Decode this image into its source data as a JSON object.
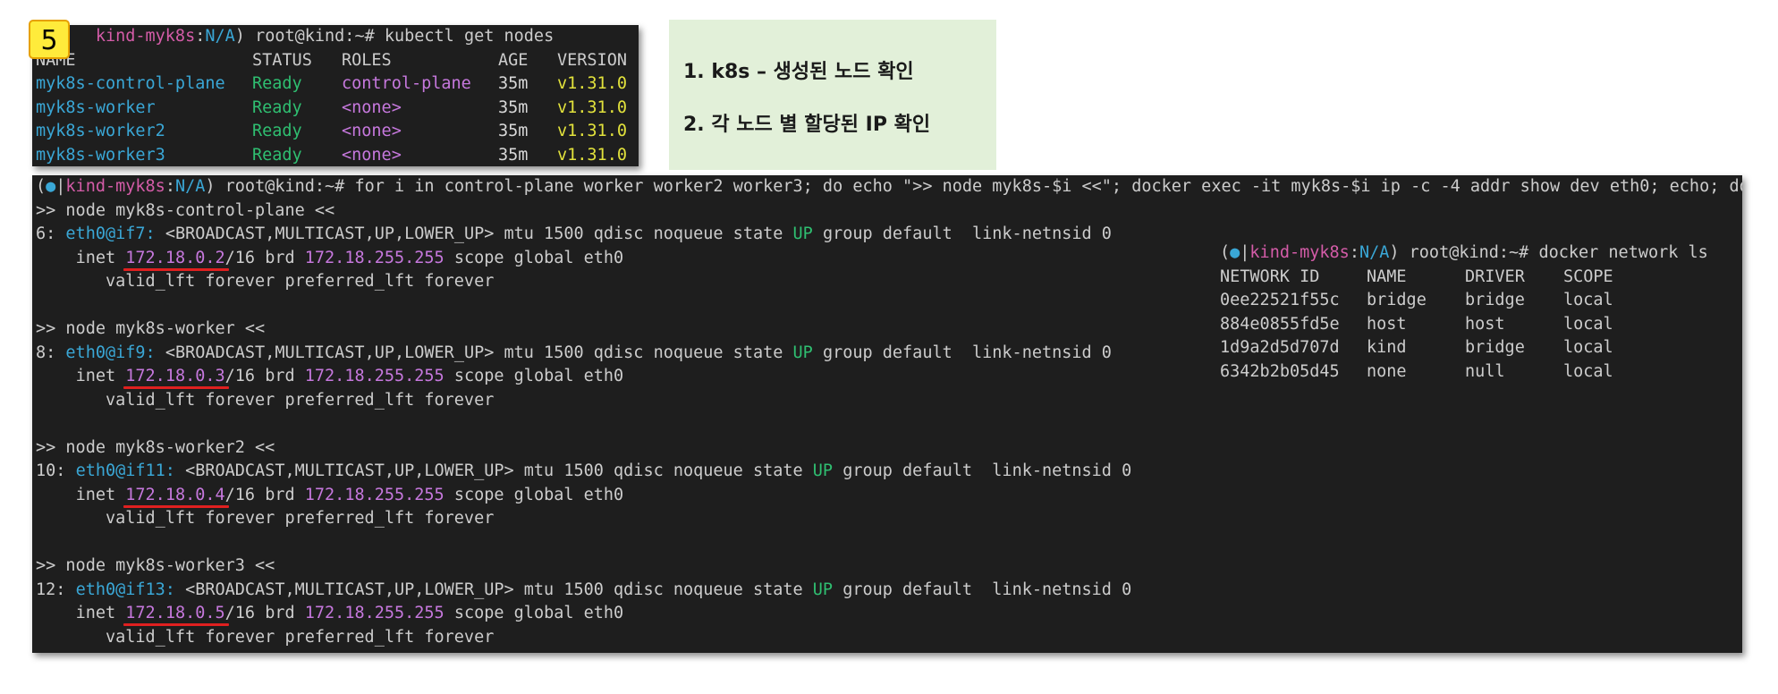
{
  "badge": {
    "number": "5"
  },
  "notes": [
    "1. k8s – 생성된 노드 확인",
    "2. 각 노드 별 할당된 IP 확인"
  ],
  "nodes_terminal": {
    "prompt_ctx": "kind-myk8s",
    "prompt_ns": "N/A",
    "prompt_user": "root@kind:~#",
    "command": "kubectl get nodes",
    "headers": [
      "NAME",
      "STATUS",
      "ROLES",
      "AGE",
      "VERSION"
    ],
    "rows": [
      {
        "name": "myk8s-control-plane",
        "status": "Ready",
        "roles": "control-plane",
        "age": "35m",
        "version": "v1.31.0"
      },
      {
        "name": "myk8s-worker",
        "status": "Ready",
        "roles": "<none>",
        "age": "35m",
        "version": "v1.31.0"
      },
      {
        "name": "myk8s-worker2",
        "status": "Ready",
        "roles": "<none>",
        "age": "35m",
        "version": "v1.31.0"
      },
      {
        "name": "myk8s-worker3",
        "status": "Ready",
        "roles": "<none>",
        "age": "35m",
        "version": "v1.31.0"
      }
    ]
  },
  "ip_terminal": {
    "prompt_ctx": "kind-myk8s",
    "prompt_ns": "N/A",
    "prompt_user": "root@kind:~#",
    "command": "for i in control-plane worker worker2 worker3; do echo \">> node myk8s-$i <<\"; docker exec -it myk8s-$i ip -c -4 addr show dev eth0; echo; done",
    "blocks": [
      {
        "header": ">> node myk8s-control-plane <<",
        "idx": "6:",
        "iface": "eth0@if7:",
        "flags": "<BROADCAST,MULTICAST,UP,LOWER_UP> mtu 1500 qdisc noqueue state",
        "state": "UP",
        "tail": "group default  link-netnsid 0",
        "inet_label": "inet",
        "ip": "172.18.0.2",
        "mask": "/16 brd",
        "brd": "172.18.255.255",
        "scope": "scope global eth0",
        "valid": "valid_lft forever preferred_lft forever"
      },
      {
        "header": ">> node myk8s-worker <<",
        "idx": "8:",
        "iface": "eth0@if9:",
        "flags": "<BROADCAST,MULTICAST,UP,LOWER_UP> mtu 1500 qdisc noqueue state",
        "state": "UP",
        "tail": "group default  link-netnsid 0",
        "inet_label": "inet",
        "ip": "172.18.0.3",
        "mask": "/16 brd",
        "brd": "172.18.255.255",
        "scope": "scope global eth0",
        "valid": "valid_lft forever preferred_lft forever"
      },
      {
        "header": ">> node myk8s-worker2 <<",
        "idx": "10:",
        "iface": "eth0@if11:",
        "flags": "<BROADCAST,MULTICAST,UP,LOWER_UP> mtu 1500 qdisc noqueue state",
        "state": "UP",
        "tail": "group default  link-netnsid 0",
        "inet_label": "inet",
        "ip": "172.18.0.4",
        "mask": "/16 brd",
        "brd": "172.18.255.255",
        "scope": "scope global eth0",
        "valid": "valid_lft forever preferred_lft forever"
      },
      {
        "header": ">> node myk8s-worker3 <<",
        "idx": "12:",
        "iface": "eth0@if13:",
        "flags": "<BROADCAST,MULTICAST,UP,LOWER_UP> mtu 1500 qdisc noqueue state",
        "state": "UP",
        "tail": "group default  link-netnsid 0",
        "inet_label": "inet",
        "ip": "172.18.0.5",
        "mask": "/16 brd",
        "brd": "172.18.255.255",
        "scope": "scope global eth0",
        "valid": "valid_lft forever preferred_lft forever"
      }
    ]
  },
  "network_terminal": {
    "prompt_ctx": "kind-myk8s",
    "prompt_ns": "N/A",
    "prompt_user": "root@kind:~#",
    "command": "docker network ls",
    "headers": [
      "NETWORK ID",
      "NAME",
      "DRIVER",
      "SCOPE"
    ],
    "rows": [
      {
        "id": "0ee22521f55c",
        "name": "bridge",
        "driver": "bridge",
        "scope": "local"
      },
      {
        "id": "884e0855fd5e",
        "name": "host",
        "driver": "host",
        "scope": "local"
      },
      {
        "id": "1d9a2d5d707d",
        "name": "kind",
        "driver": "bridge",
        "scope": "local"
      },
      {
        "id": "6342b2b05d45",
        "name": "none",
        "driver": "null",
        "scope": "local"
      }
    ]
  }
}
